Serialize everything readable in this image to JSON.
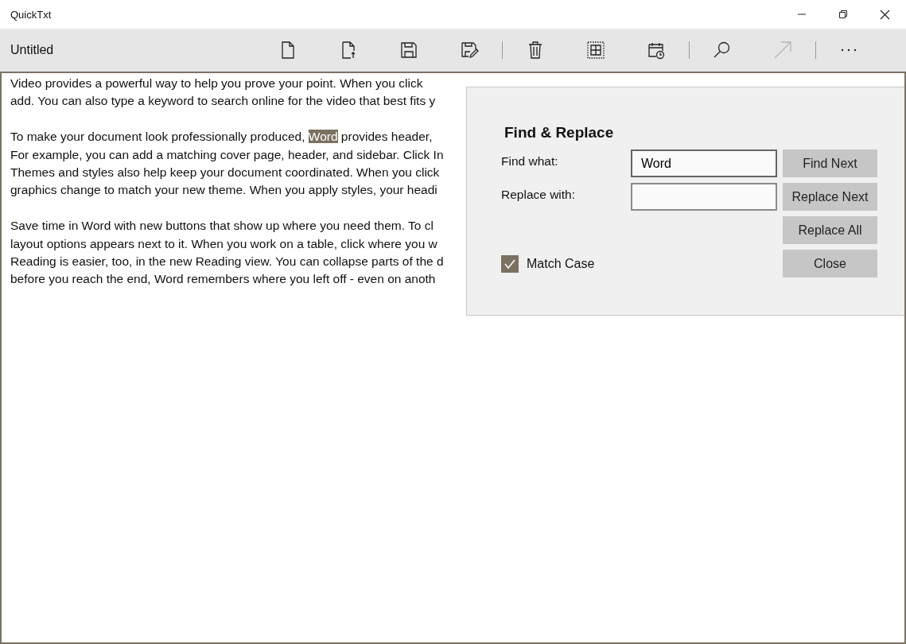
{
  "window": {
    "title": "QuickTxt"
  },
  "toolbar": {
    "document_title": "Untitled",
    "tools": [
      {
        "kind": "new",
        "disabled": false
      },
      {
        "kind": "open",
        "disabled": false
      },
      {
        "kind": "save",
        "disabled": false
      },
      {
        "kind": "save_as",
        "disabled": false
      },
      {
        "kind": "separator"
      },
      {
        "kind": "delete",
        "disabled": false
      },
      {
        "kind": "select_all",
        "disabled": false
      },
      {
        "kind": "date",
        "disabled": false
      },
      {
        "kind": "separator"
      },
      {
        "kind": "find",
        "disabled": false
      },
      {
        "kind": "share",
        "disabled": true
      },
      {
        "kind": "separator"
      },
      {
        "kind": "more",
        "disabled": false
      }
    ]
  },
  "document": {
    "paragraphs": [
      [
        [
          {
            "text": "Video provides a powerful way to help you prove your point. When you click",
            "highlighted": false
          }
        ],
        [
          {
            "text": "add. You can also type a keyword to search online for the video that best fits y",
            "highlighted": false
          }
        ]
      ],
      [
        [
          {
            "text": "To make your document look professionally produced, ",
            "highlighted": false
          },
          {
            "text": "Word",
            "highlighted": true
          },
          {
            "text": " provides header,",
            "highlighted": false
          }
        ],
        [
          {
            "text": "For example, you can add a matching cover page, header, and sidebar. Click In",
            "highlighted": false
          }
        ],
        [
          {
            "text": "Themes and styles also help keep your document coordinated. When you click",
            "highlighted": false
          }
        ],
        [
          {
            "text": "graphics change to match your new theme. When you apply styles, your headi",
            "highlighted": false
          }
        ]
      ],
      [
        [
          {
            "text": "Save time in Word with new buttons that show up where you need them. To cl",
            "highlighted": false
          }
        ],
        [
          {
            "text": "layout options appears next to it. When you work on a table, click where you w",
            "highlighted": false
          }
        ],
        [
          {
            "text": "Reading is easier, too, in the new Reading view. You can collapse parts of the d",
            "highlighted": false
          }
        ],
        [
          {
            "text": "before you reach the end, Word remembers where you left off - even on anoth",
            "highlighted": false
          }
        ]
      ]
    ]
  },
  "dialog": {
    "title": "Find & Replace",
    "find": {
      "label": "Find what:",
      "value": "Word"
    },
    "replace": {
      "label": "Replace with:"
    },
    "match_case": {
      "label": "Match Case",
      "checked": true
    },
    "buttons": [
      "Find Next",
      "Replace Next",
      "Replace All",
      "Close"
    ]
  }
}
